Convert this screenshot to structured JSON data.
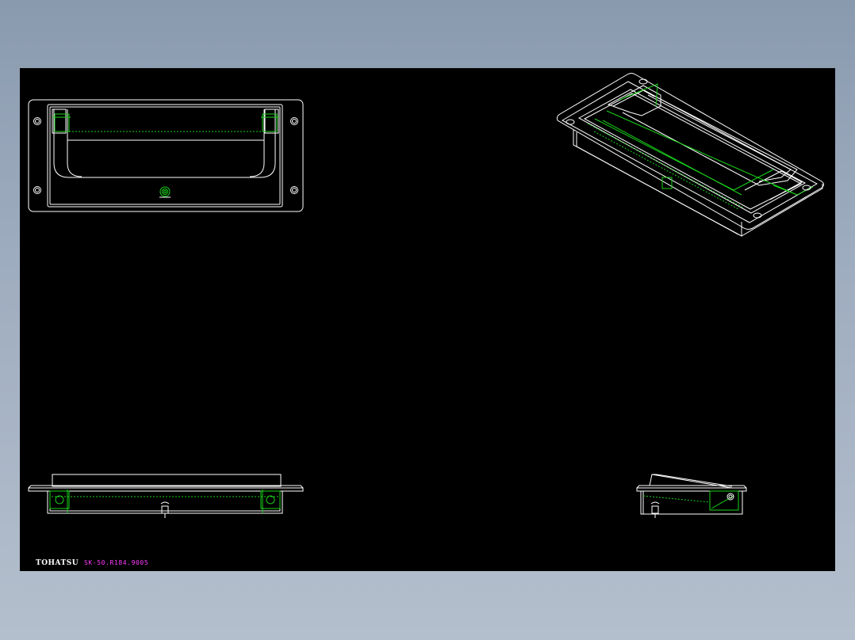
{
  "colors": {
    "background": "#000000",
    "outline": "#ffffff",
    "hidden_lines": "#19d219",
    "part_code": "#ff3cff",
    "window_frame": "#8a9aae"
  },
  "views": {
    "front": "front-view",
    "isometric": "isometric-view",
    "bottom": "side-elevation",
    "right": "end-elevation"
  },
  "title_block": {
    "logo": "TOHATSU",
    "part_code": "SK-50.R184.9005"
  }
}
